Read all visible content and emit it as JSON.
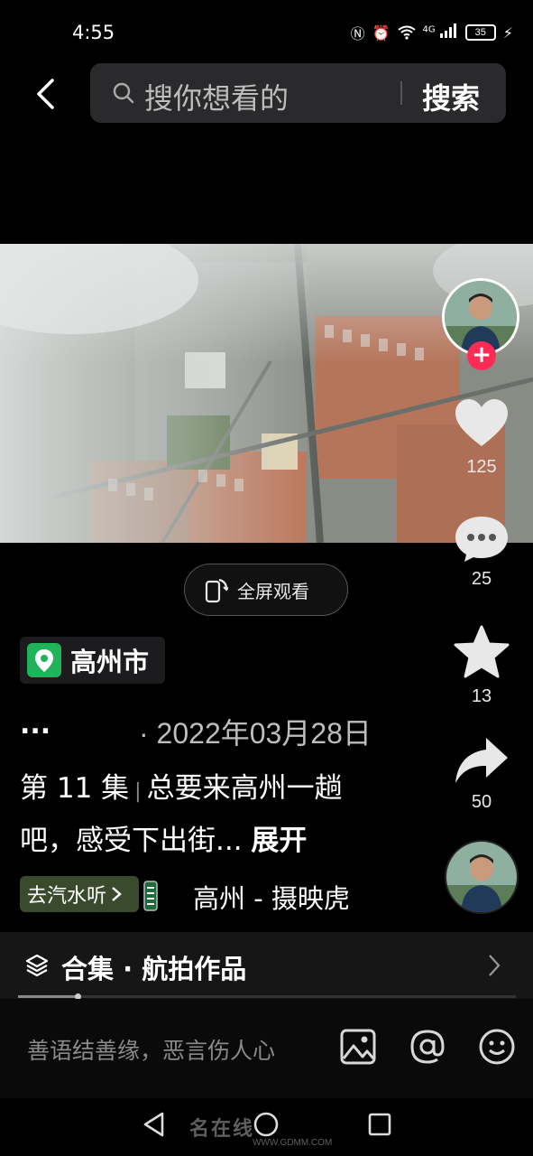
{
  "status_bar": {
    "time": "4:55",
    "network": "4G",
    "battery": "35"
  },
  "search": {
    "placeholder": "搜你想看的",
    "button_label": "搜索"
  },
  "video": {
    "fullscreen_label": "全屏观看"
  },
  "actions": {
    "likes": "125",
    "comments": "25",
    "favorites": "13",
    "shares": "50"
  },
  "post": {
    "location": "高州市",
    "author_placeholder": "...",
    "date": "· 2022年03月28日",
    "episode": "第 11 集",
    "caption": "总要来高州一趟吧，感受下出街...",
    "expand_label": "展开"
  },
  "music": {
    "chip_label": "去汽水听",
    "title": "高州 - 摄映虎"
  },
  "collection": {
    "label": "合集 · 航拍作品",
    "progress": 0.12
  },
  "comment": {
    "placeholder": "善语结善缘，恶言伤人心"
  },
  "watermark": {
    "text": "名在线",
    "sub": "WWW.GDMM.COM"
  },
  "colors": {
    "accent_red": "#fe2c55",
    "location_green": "#21b35a"
  }
}
